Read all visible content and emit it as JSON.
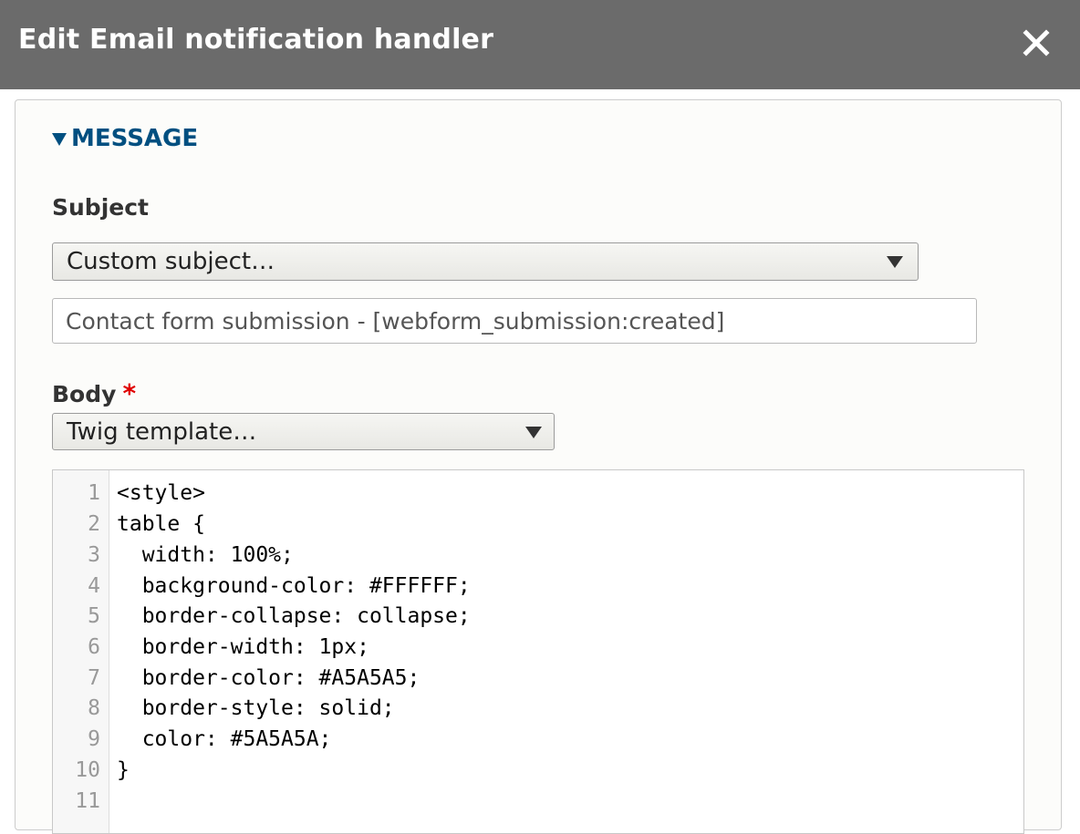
{
  "dialog": {
    "title": "Edit Email notification handler",
    "close_label": "×"
  },
  "message_section": {
    "summary": "MESSAGE",
    "expanded": true
  },
  "subject": {
    "label": "Subject",
    "select_value": "Custom subject…",
    "input_value": "Contact form submission - [webform_submission:created]"
  },
  "body": {
    "label": "Body",
    "required_marker": "*",
    "select_value": "Twig template…",
    "code_lines": [
      {
        "number": "1",
        "text": "<style>"
      },
      {
        "number": "2",
        "text": "table {"
      },
      {
        "number": "3",
        "text": "  width: 100%;"
      },
      {
        "number": "4",
        "text": "  background-color: #FFFFFF;"
      },
      {
        "number": "5",
        "text": "  border-collapse: collapse;"
      },
      {
        "number": "6",
        "text": "  border-width: 1px;"
      },
      {
        "number": "7",
        "text": "  border-color: #A5A5A5;"
      },
      {
        "number": "8",
        "text": "  border-style: solid;"
      },
      {
        "number": "9",
        "text": "  color: #5A5A5A;"
      },
      {
        "number": "10",
        "text": "}"
      },
      {
        "number": "11",
        "text": ""
      }
    ]
  },
  "colors": {
    "titlebar": "#6b6b6b",
    "link_blue": "#004f80",
    "required_red": "#e00000"
  }
}
